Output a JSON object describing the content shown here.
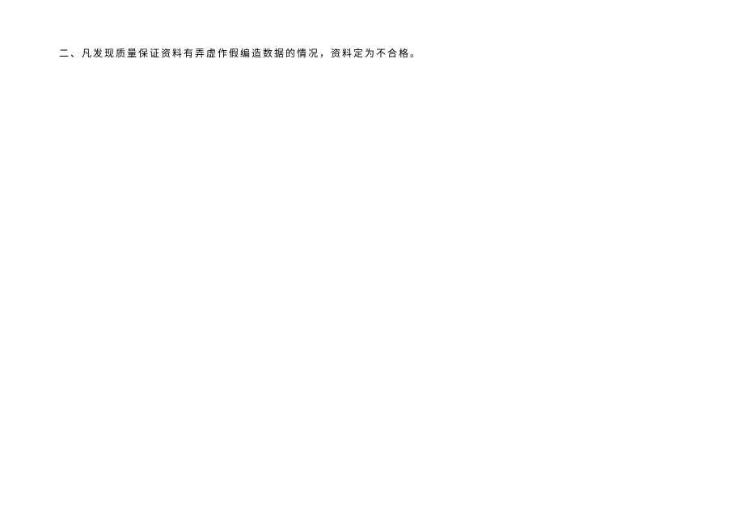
{
  "paragraph": {
    "text": "二、凡发现质量保证资料有弄虚作假编造数据的情况，资料定为不合格。"
  }
}
